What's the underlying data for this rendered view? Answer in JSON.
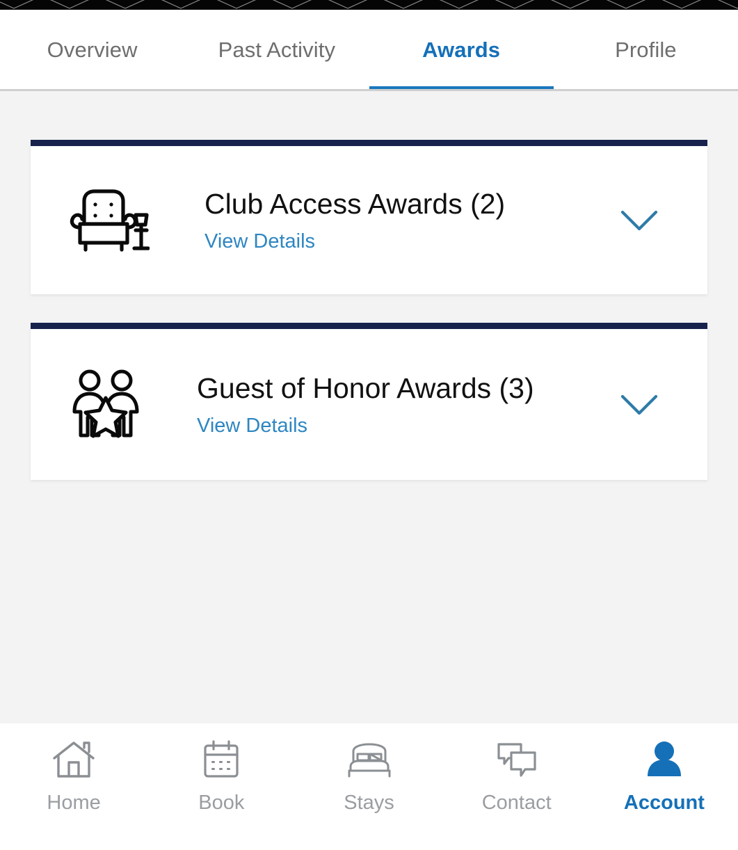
{
  "app": {
    "screen_title": "Awards",
    "accent_blue": "#1570b8",
    "link_blue": "#2e86c1",
    "card_border_navy": "#17214c",
    "inactive_gray": "#6e6e6e",
    "nav_inactive_gray": "#9a9da1",
    "page_background": "#f3f3f3"
  },
  "tabs": [
    {
      "label": "Overview",
      "active": false,
      "name": "tab-overview"
    },
    {
      "label": "Past Activity",
      "active": false,
      "name": "tab-past-activity"
    },
    {
      "label": "Awards",
      "active": true,
      "name": "tab-awards"
    },
    {
      "label": "Profile",
      "active": false,
      "name": "tab-profile"
    }
  ],
  "cards": [
    {
      "title": "Club Access Awards (2)",
      "count": 2,
      "link_label": "View Details",
      "icon": "armchair-icon",
      "chevron": "chevron-down-icon",
      "expanded": false
    },
    {
      "title": "Guest of Honor Awards (3)",
      "count": 3,
      "link_label": "View Details",
      "icon": "two-people-star-icon",
      "chevron": "chevron-down-icon",
      "expanded": false
    }
  ],
  "bottom_nav": [
    {
      "label": "Home",
      "icon": "house-icon",
      "active": false
    },
    {
      "label": "Book",
      "icon": "calendar-icon",
      "active": false
    },
    {
      "label": "Stays",
      "icon": "bed-icon",
      "active": false
    },
    {
      "label": "Contact",
      "icon": "chat-bubbles-icon",
      "active": false
    },
    {
      "label": "Account",
      "icon": "person-icon",
      "active": true
    }
  ]
}
